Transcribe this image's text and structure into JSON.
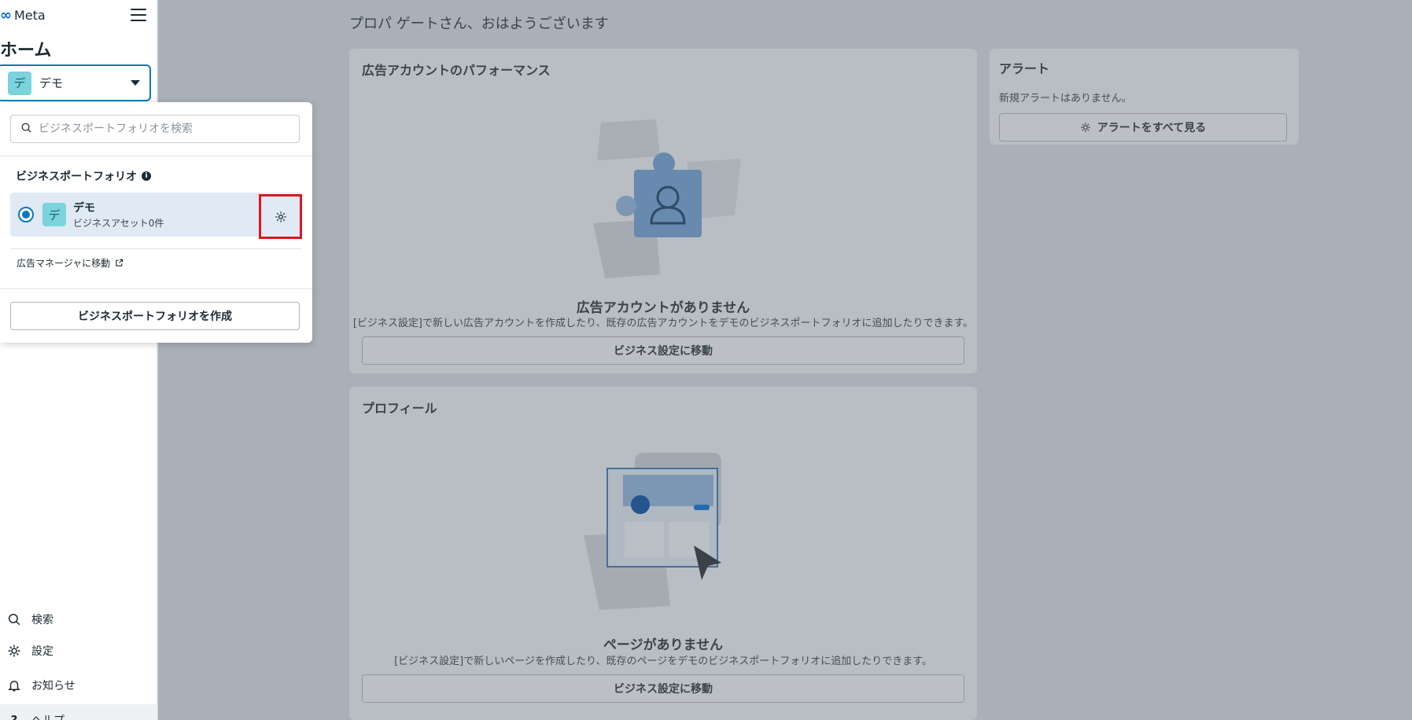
{
  "sidebar": {
    "logo": "Meta",
    "home_title": "ホーム",
    "selected_business": {
      "avatar": "デ",
      "name": "デモ"
    },
    "nav": [
      {
        "label": "検索",
        "icon": "search-icon"
      },
      {
        "label": "設定",
        "icon": "gear-icon"
      },
      {
        "label": "お知らせ",
        "icon": "bell-icon"
      },
      {
        "label": "ヘルプ",
        "icon": "help-icon"
      }
    ]
  },
  "popover": {
    "search_placeholder": "ビジネスポートフォリオを検索",
    "section_label": "ビジネスポートフォリオ",
    "portfolio": {
      "avatar": "デ",
      "name": "デモ",
      "sub": "ビジネスアセット0件"
    },
    "ads_manager_link": "広告マネージャに移動",
    "create_button": "ビジネスポートフォリオを作成"
  },
  "main": {
    "greeting": "プロパ ゲートさん、おはようございます",
    "ad_card": {
      "title": "広告アカウントのパフォーマンス",
      "empty_title": "広告アカウントがありません",
      "empty_sub": "[ビジネス設定]で新しい広告アカウントを作成したり、既存の広告アカウントをデモのビジネスポートフォリオに追加したりできます。",
      "button": "ビジネス設定に移動"
    },
    "profile_card": {
      "title": "プロフィール",
      "empty_title": "ページがありません",
      "empty_sub": "[ビジネス設定]で新しいページを作成したり、既存のページをデモのビジネスポートフォリオに追加したりできます。",
      "button": "ビジネス設定に移動"
    },
    "alert_card": {
      "title": "アラート",
      "message": "新規アラートはありません。",
      "button": "アラートをすべて見る"
    }
  },
  "colors": {
    "accent": "#0a78be",
    "highlight": "#e0141e",
    "avatar_bg": "#7bd3dc"
  }
}
